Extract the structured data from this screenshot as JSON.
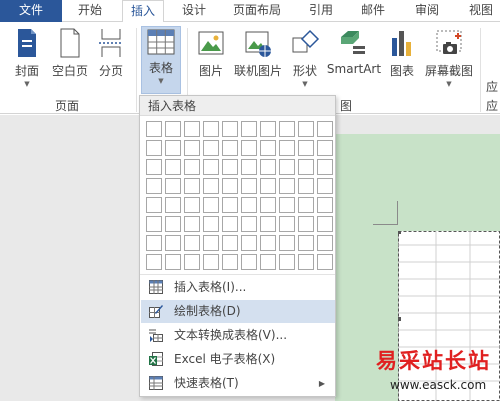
{
  "tabs": [
    {
      "label": "文件"
    },
    {
      "label": "开始"
    },
    {
      "label": "插入"
    },
    {
      "label": "设计"
    },
    {
      "label": "页面布局"
    },
    {
      "label": "引用"
    },
    {
      "label": "邮件"
    },
    {
      "label": "审阅"
    },
    {
      "label": "视图"
    }
  ],
  "ribbon": {
    "pages_group": {
      "label": "页面",
      "buttons": [
        {
          "label": "封面",
          "icon": "cover-page-icon"
        },
        {
          "label": "空白页",
          "icon": "blank-page-icon"
        },
        {
          "label": "分页",
          "icon": "page-break-icon"
        }
      ]
    },
    "table_button": {
      "label": "表格",
      "icon": "table-icon"
    },
    "illustrations_group": {
      "label_partial": "图",
      "buttons": [
        {
          "label": "图片",
          "icon": "picture-icon"
        },
        {
          "label": "联机图片",
          "icon": "online-picture-icon"
        },
        {
          "label": "形状",
          "icon": "shapes-icon"
        },
        {
          "label": "SmartArt",
          "icon": "smartart-icon"
        },
        {
          "label": "图表",
          "icon": "chart-icon"
        },
        {
          "label": "屏幕截图",
          "icon": "screenshot-icon"
        }
      ]
    },
    "cut_off_label": "应",
    "cut_off_label2": "应"
  },
  "dropdown": {
    "header": "插入表格",
    "grid": {
      "rows": 8,
      "cols": 10
    },
    "items": [
      {
        "label": "插入表格(I)...",
        "icon": "table-insert-icon",
        "submenu": false
      },
      {
        "label": "绘制表格(D)",
        "icon": "draw-table-icon",
        "submenu": false
      },
      {
        "label": "文本转换成表格(V)...",
        "icon": "text-to-table-icon",
        "submenu": false
      },
      {
        "label": "Excel 电子表格(X)",
        "icon": "excel-icon",
        "submenu": false
      },
      {
        "label": "快速表格(T)",
        "icon": "quick-table-icon",
        "submenu": true
      }
    ]
  },
  "watermark": {
    "title": "易采站长站",
    "url": "www.easck.com"
  },
  "colors": {
    "accent": "#2b579a",
    "hover": "#d4e0ef",
    "pressed": "#c5d6ec",
    "page_bg": "#c8e2c8",
    "watermark": "#e02020"
  }
}
